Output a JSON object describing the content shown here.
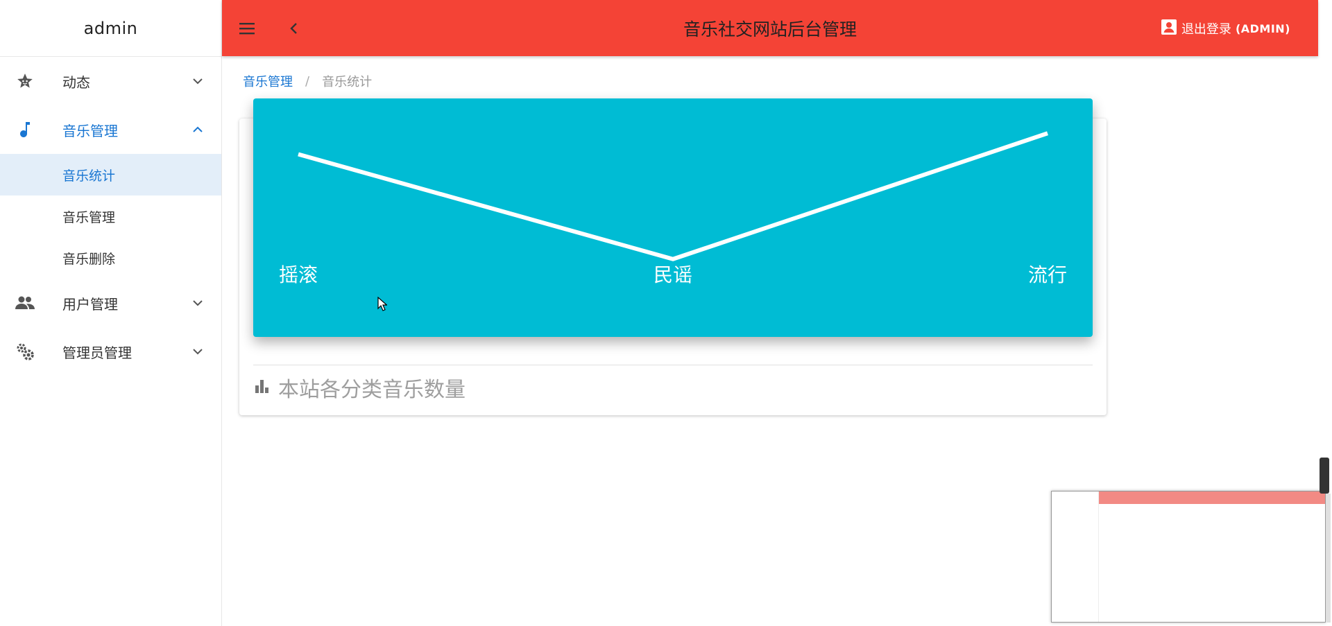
{
  "app": {
    "brand": "admin",
    "title": "音乐社交网站后台管理",
    "logout_label": "退出登录",
    "logout_user": "(ADMIN)"
  },
  "colors": {
    "topbar": "#f44336",
    "chart_bg": "#00bcd4",
    "accent": "#1976d2",
    "selected_bg": "#e3eef9"
  },
  "sidebar": {
    "groups": [
      {
        "label": "动态",
        "icon": "star-face-icon",
        "expanded": false
      },
      {
        "label": "音乐管理",
        "icon": "music-note-icon",
        "expanded": true,
        "children": [
          "音乐统计",
          "音乐管理",
          "音乐删除"
        ],
        "selected_child": 0
      },
      {
        "label": "用户管理",
        "icon": "people-icon",
        "expanded": false
      },
      {
        "label": "管理员管理",
        "icon": "gears-icon",
        "expanded": false
      }
    ]
  },
  "breadcrumb": {
    "parent": "音乐管理",
    "separator": "/",
    "current": "音乐统计"
  },
  "card": {
    "footer_title": "本站各分类音乐数量",
    "footer_icon": "bar-chart-icon"
  },
  "chart_data": {
    "type": "line",
    "categories": [
      "摇滚",
      "民谣",
      "流行"
    ],
    "values": [
      8,
      3,
      9
    ],
    "ylim": [
      2,
      10
    ],
    "grid": false,
    "title": ""
  }
}
